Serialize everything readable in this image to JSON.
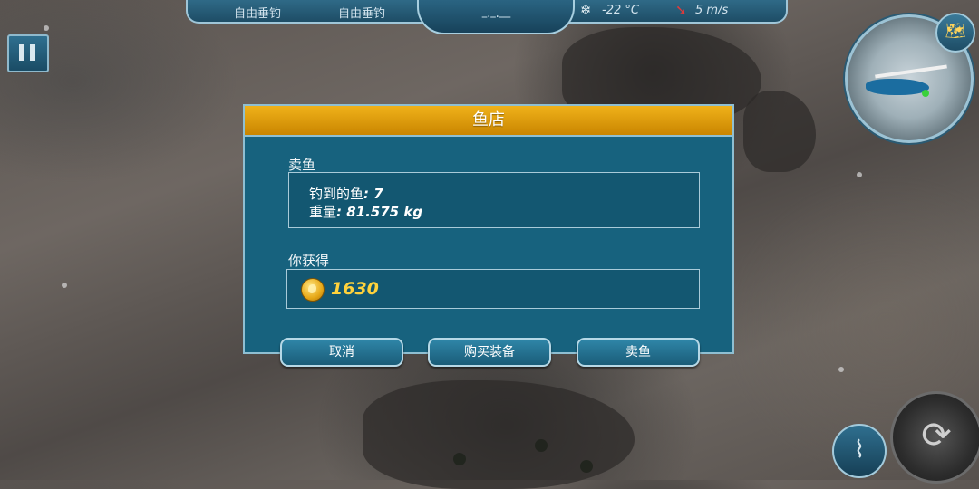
{
  "hud": {
    "tabs": [
      "自由垂钓",
      "自由垂钓"
    ],
    "center_indicator": "–·–·—",
    "temperature": "-22 °C",
    "wind": "5 m/s",
    "temperature_icon": "snowflake-icon",
    "wind_icon": "wind-arrow-icon"
  },
  "dialog": {
    "title": "鱼店",
    "sell_section_label": "卖鱼",
    "fish_caught_label": "钓到的鱼",
    "fish_caught_value": ": 7",
    "weight_label": "重量",
    "weight_value": ": 81.575 kg",
    "earn_section_label": "你获得",
    "earned_amount": "1630",
    "buttons": {
      "cancel": "取消",
      "buy_gear": "购买装备",
      "sell_fish": "卖鱼"
    }
  },
  "colors": {
    "header_gold": "#f0b21a",
    "panel_teal": "#17627e",
    "coin_gold": "#ffd23c"
  }
}
